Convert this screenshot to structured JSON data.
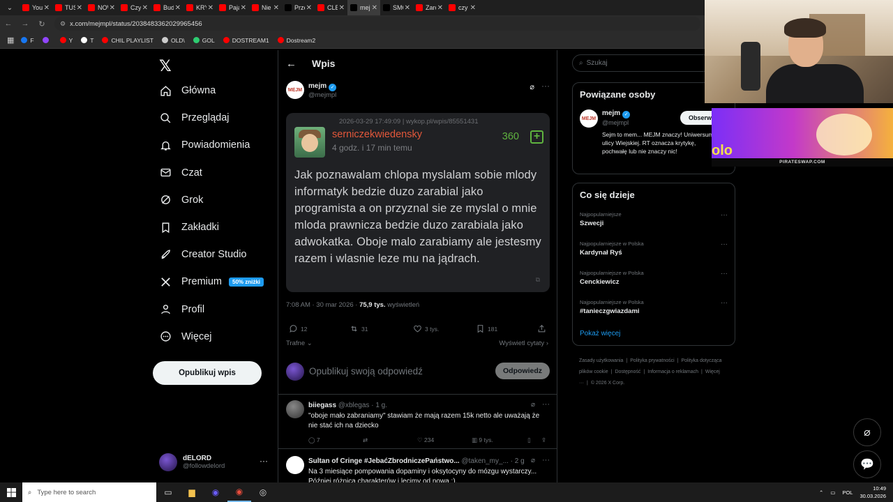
{
  "browser": {
    "tabs": [
      {
        "label": "YouTu",
        "color": "#ff0000"
      },
      {
        "label": "TUSK",
        "color": "#ff0000"
      },
      {
        "label": "NOW",
        "color": "#ff0000"
      },
      {
        "label": "Czy P",
        "color": "#ff0000"
      },
      {
        "label": "Buduj",
        "color": "#ff0000"
      },
      {
        "label": "KRYZ",
        "color": "#ff0000"
      },
      {
        "label": "Pająk",
        "color": "#ff0000"
      },
      {
        "label": "Nie g",
        "color": "#ff0000"
      },
      {
        "label": "Przem",
        "color": "#000000"
      },
      {
        "label": "CLEA",
        "color": "#ff0000"
      },
      {
        "label": "mejm",
        "color": "#000000"
      },
      {
        "label": "SMOC",
        "color": "#000000"
      },
      {
        "label": "Zarob",
        "color": "#ff0000"
      },
      {
        "label": "czy p",
        "color": "#ff0000"
      }
    ],
    "url": "x.com/mejmpl/status/2038483362029965456",
    "bookmarks": [
      {
        "label": "F",
        "color": "#1877f2"
      },
      {
        "label": "",
        "color": "#9146ff"
      },
      {
        "label": "Y",
        "color": "#ff0000"
      },
      {
        "label": "T",
        "color": "#ffffff"
      },
      {
        "label": "CHIL PLAYLIST",
        "color": "#ff0000"
      },
      {
        "label": "OLD\\",
        "color": "#cccccc"
      },
      {
        "label": "GOL",
        "color": "#2ecc71"
      },
      {
        "label": "DOSTREAM1",
        "color": "#ff0000"
      },
      {
        "label": "Dostream2",
        "color": "#ff0000"
      }
    ]
  },
  "nav": {
    "items": [
      {
        "label": "Główna",
        "icon": "home-icon"
      },
      {
        "label": "Przeglądaj",
        "icon": "search-icon"
      },
      {
        "label": "Powiadomienia",
        "icon": "bell-icon"
      },
      {
        "label": "Czat",
        "icon": "mail-icon"
      },
      {
        "label": "Grok",
        "icon": "grok-icon"
      },
      {
        "label": "Zakładki",
        "icon": "bookmark-icon"
      },
      {
        "label": "Creator Studio",
        "icon": "rocket-icon"
      },
      {
        "label": "Premium",
        "icon": "x-icon"
      },
      {
        "label": "Profil",
        "icon": "person-icon"
      },
      {
        "label": "Więcej",
        "icon": "more-circle-icon"
      }
    ],
    "premium_badge": "50% zniżki",
    "publish": "Opublikuj wpis",
    "account": {
      "name": "dELORD",
      "handle": "@followdelord"
    }
  },
  "header": {
    "title": "Wpis"
  },
  "post": {
    "author": "mejm",
    "handle": "@mejmpl",
    "wykop": {
      "meta": "2026-03-29 17:49:09 | wykop.pl/wpis/85551431",
      "user": "serniczekwiedensky",
      "time": "4 godz. i 17 min temu",
      "score": "360",
      "text": "Jak poznawalam chlopa myslalam sobie mlody informatyk bedzie duzo zarabial jako programista a on przyznal sie ze myslal o mnie mloda prawnicza bedzie duzo zarabiala jako adwokatka. Oboje malo zarabiamy ale jestesmy razem i wlasnie leze mu na jądrach."
    },
    "timestamp": "7:08 AM · 30 mar 2026 · ",
    "views": "75,9 tys.",
    "views_label": " wyświetleń",
    "counts": {
      "replies": "12",
      "reposts": "31",
      "likes": "3 tys.",
      "bookmarks": "181"
    },
    "sort": "Trafne",
    "quotes": "Wyświetl cytaty"
  },
  "reply_box": {
    "placeholder": "Opublikuj swoją odpowiedź",
    "button": "Odpowiedz"
  },
  "replies": [
    {
      "name": "biiegass",
      "handle": "@xblegas · 1 g.",
      "text": "\"oboje mało zabraniamy\" stawiam że mają razem 15k netto ale uważają że nie stać ich na dziecko",
      "replies": "7",
      "reposts": "",
      "likes": "234",
      "views": "9 tys."
    },
    {
      "name": "Sultan of Cringe #JebaćZbrodniczePaństwo...",
      "handle": "@taken_my_... · 2 g.",
      "text": "Na 3 miesiące pompowania dopaminy i oksytocyny do mózgu wystarczy... Później różnica charakterów i lecimy od nowa :)."
    }
  ],
  "right": {
    "search_placeholder": "Szukaj",
    "related": {
      "title": "Powiązane osoby",
      "name": "mejm",
      "handle": "@mejmpl",
      "follow": "Obserwuj",
      "bio": "Sejm to mem... MEJM znaczy! Uniwersum z ulicy Wiejskiej. RT oznacza krytykę, pochwałę lub nie znaczy nic!"
    },
    "trends": {
      "title": "Co się dzieje",
      "items": [
        {
          "context": "Najpopularniejsze",
          "name": "Szwecji"
        },
        {
          "context": "Najpopularniejsze w Polska",
          "name": "Kardynał Ryś"
        },
        {
          "context": "Najpopularniejsze w Polska",
          "name": "Cenckiewicz"
        },
        {
          "context": "Najpopularniejsze w Polska",
          "name": "#tanieczgwiazdami"
        }
      ],
      "show_more": "Pokaż więcej"
    },
    "footer": [
      "Zasady użytkowania",
      "Polityka prywatności",
      "Polityka dotycząca plików cookie",
      "Dostępność",
      "Informacja o reklamach",
      "Więcej ···",
      "© 2026 X Corp."
    ]
  },
  "overlay": {
    "ad_caption": "PIRATESWAP.COM"
  },
  "taskbar": {
    "search": "Type here to search",
    "lang": "POL",
    "time": "10:49",
    "date": "30.03.2026"
  }
}
